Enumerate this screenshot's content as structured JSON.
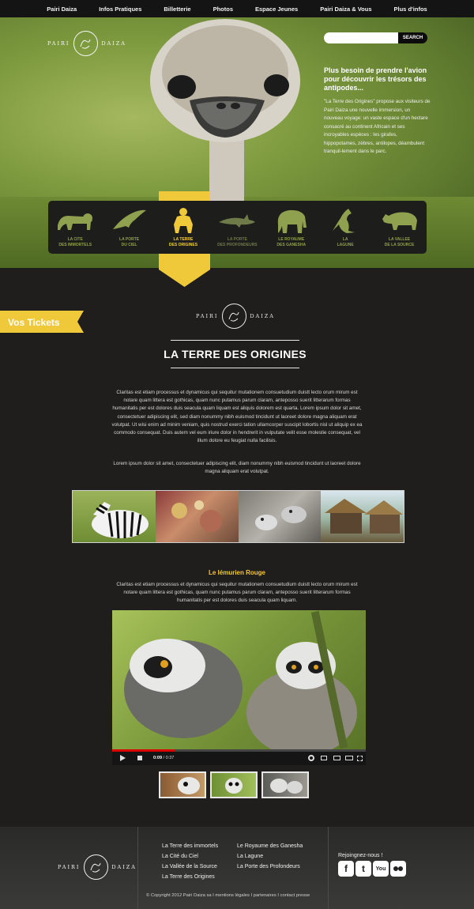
{
  "nav": [
    "Pairi Daiza",
    "Infos Pratiques",
    "Billetterie",
    "Photos",
    "Espace Jeunes",
    "Pairi Daiza & Vous",
    "Plus d'infos"
  ],
  "brand": {
    "left": "PAIRI",
    "right": "DAIZA"
  },
  "search": {
    "placeholder": "",
    "button": "SEARCH"
  },
  "hero": {
    "title": "Plus besoin de prendre l'avion pour découvrir les trésors des antipodes...",
    "text": "\"La Terre des Origines\" propose aux visiteurs de Pairi Daiza une nouvelle immersion, un nouveau voyage: un vaste espace d'un hectare consacré au continent Africain et ses incroyables espèces : les girafes, hippopotames, zèbres, antilopes, déambulent tranquil-lement dans le parc."
  },
  "categories": [
    {
      "line1": "LA CITE",
      "line2": "DES IMMORTELS",
      "icon": "lion-icon"
    },
    {
      "line1": "LA PORTE",
      "line2": "DU CIEL",
      "icon": "eagle-icon"
    },
    {
      "line1": "LA TERRE",
      "line2": "DES ORIGINES",
      "icon": "ape-icon",
      "active": true
    },
    {
      "line1": "LA PORTE",
      "line2": "DES PROFONDEURS",
      "icon": "shark-icon"
    },
    {
      "line1": "LE ROYAUME",
      "line2": "DES GANESHA",
      "icon": "elephant-icon"
    },
    {
      "line1": "LA",
      "line2": "LAGUNE",
      "icon": "kangaroo-icon"
    },
    {
      "line1": "LA VALLEE",
      "line2": "DE LA SOURCE",
      "icon": "rhino-icon"
    }
  ],
  "tickets": "Vos Tickets",
  "page_title": "LA TERRE DES ORIGINES",
  "intro": "Claritas est etiam processus et dynamicus qui sequitur mutationem consuetudium duistt lecto orum mirum est notare quam littera est gothicas, quam nunc putamus parum claram, anteposso suerit litterarum formas humanitatis per est dolores duis seacula quam liquam est aliquis dolorem est quarta. Lorem ipsum dolor sit amet, consectetuer adipiscing elit, sed diam nonummy nibh euismod tincidunt ut laoreet dolore magna aliquam erat volutpat. Ut wisi enim ad minim veniam, quis nostrud exerci tation ullamcorper suscipit lobortis nisl ut aliquip ex ea commodo consequat. Duis autem vel eum iriure dolor in hendrerit in vulputate velit esse molestie consequat, vel illum dolore eu feugiat nulla facilisis.",
  "intro2": "Lorem ipsum dolor sit amet, consectetuer adipiscing elit, diam nonummy nibh euismod tincidunt ut laoreet dolore magna aliquam erat volutpat.",
  "subtitle": "Le lémurien Rouge",
  "sub_text": "Claritas est etiam processus et dynamicus qui sequitur mutationem consuetudium duistt lecto orum mirum est notare quam littera est gothicas, quam nunc putamus parum claram, anteposso suerit litterarum formas humanitatis per est dolores duis seacula quam liquam.",
  "video": {
    "current": "0:09",
    "duration": "0:37",
    "progress": 0.25
  },
  "footer": {
    "col1": [
      "La Terre des immortels",
      "La Cité du Ciel",
      "La Vallée de la Source",
      "La Terre des Origines"
    ],
    "col2": [
      "Le Royaume des Ganesha",
      "La Lagune",
      "La Porte des Profondeurs"
    ],
    "join": "Rejoingnez-nous !",
    "social": [
      "facebook-icon",
      "twitter-icon",
      "youtube-icon",
      "flickr-icon"
    ],
    "copyright": "© Copyright 2012 Pairi Daiza sa  I  mentions légales  I  partenaires  I  contact presse"
  },
  "colors": {
    "accent": "#f0c93a",
    "icon_green": "#8fa04e",
    "bg": "#1f1e1c"
  }
}
